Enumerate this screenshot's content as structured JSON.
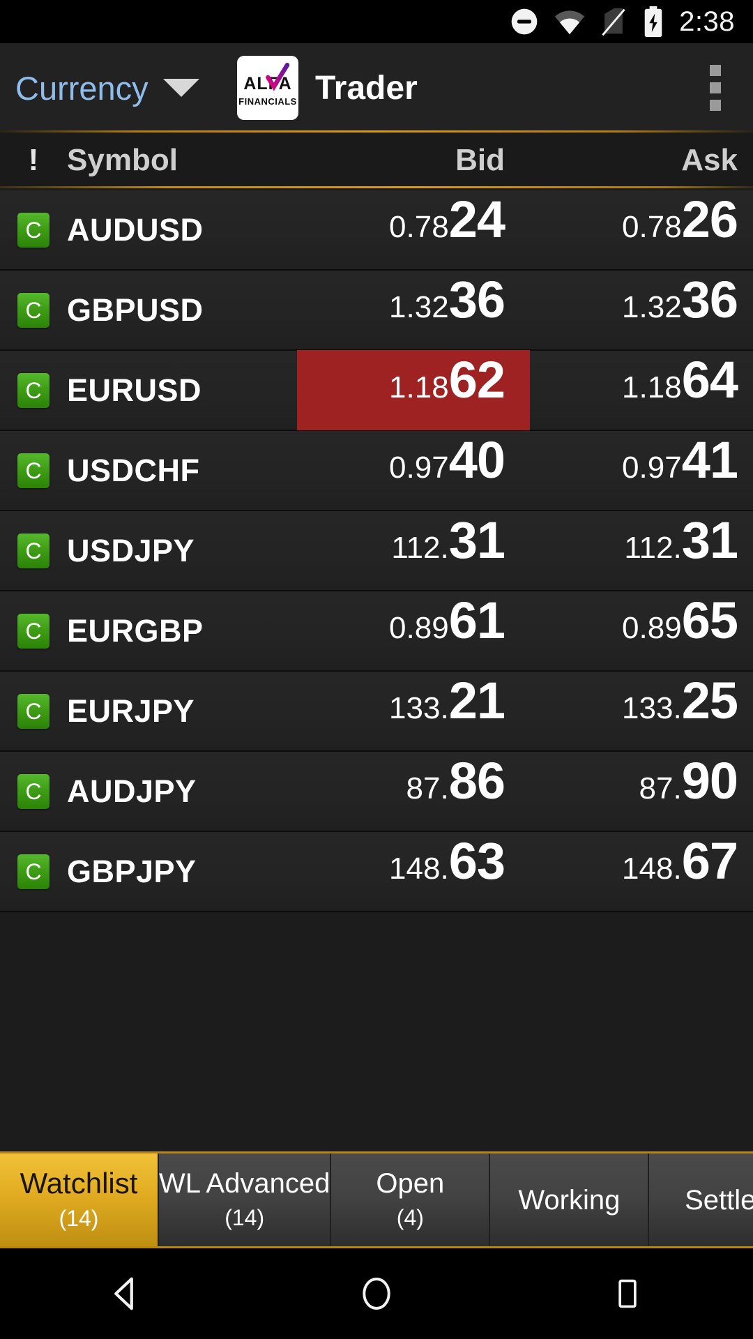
{
  "status_bar": {
    "time": "2:38",
    "icons": [
      "do-not-disturb-icon",
      "wifi-icon",
      "no-sim-icon",
      "battery-charging-icon"
    ]
  },
  "app_bar": {
    "currency_selector": "Currency",
    "dropdown_icon": "spinner-caret-icon",
    "logo_primary": "ALFA",
    "logo_secondary": "FINANCIALS",
    "title": "Trader",
    "overflow_icon": "overflow-menu-icon"
  },
  "table": {
    "headers": {
      "alert": "!",
      "symbol": "Symbol",
      "bid": "Bid",
      "ask": "Ask"
    },
    "rows": [
      {
        "flag": "C",
        "symbol": "AUDUSD",
        "bid_small": "0.78",
        "bid_big": "24",
        "ask_small": "0.78",
        "ask_big": "26",
        "bid_flash": "none"
      },
      {
        "flag": "C",
        "symbol": "GBPUSD",
        "bid_small": "1.32",
        "bid_big": "36",
        "ask_small": "1.32",
        "ask_big": "36",
        "bid_flash": "none"
      },
      {
        "flag": "C",
        "symbol": "EURUSD",
        "bid_small": "1.18",
        "bid_big": "62",
        "ask_small": "1.18",
        "ask_big": "64",
        "bid_flash": "down"
      },
      {
        "flag": "C",
        "symbol": "USDCHF",
        "bid_small": "0.97",
        "bid_big": "40",
        "ask_small": "0.97",
        "ask_big": "41",
        "bid_flash": "none"
      },
      {
        "flag": "C",
        "symbol": "USDJPY",
        "bid_small": "112.",
        "bid_big": "31",
        "ask_small": "112.",
        "ask_big": "31",
        "bid_flash": "none"
      },
      {
        "flag": "C",
        "symbol": "EURGBP",
        "bid_small": "0.89",
        "bid_big": "61",
        "ask_small": "0.89",
        "ask_big": "65",
        "bid_flash": "none"
      },
      {
        "flag": "C",
        "symbol": "EURJPY",
        "bid_small": "133.",
        "bid_big": "21",
        "ask_small": "133.",
        "ask_big": "25",
        "bid_flash": "none"
      },
      {
        "flag": "C",
        "symbol": "AUDJPY",
        "bid_small": "87.",
        "bid_big": "86",
        "ask_small": "87.",
        "ask_big": "90",
        "bid_flash": "none"
      },
      {
        "flag": "C",
        "symbol": "GBPJPY",
        "bid_small": "148.",
        "bid_big": "63",
        "ask_small": "148.",
        "ask_big": "67",
        "bid_flash": "none"
      }
    ]
  },
  "tabs": [
    {
      "label": "Watchlist",
      "count": "(14)",
      "active": true
    },
    {
      "label": "WL Advanced",
      "count": "(14)",
      "active": false
    },
    {
      "label": "Open",
      "count": "(4)",
      "active": false
    },
    {
      "label": "Working",
      "count": "",
      "active": false
    },
    {
      "label": "Settled",
      "count": "",
      "active": false
    }
  ],
  "nav_bar": {
    "back": "back-icon",
    "home": "home-icon",
    "recents": "recents-icon"
  },
  "colors": {
    "accent_gold": "#d79a1c",
    "flash_down_red": "#9e2222",
    "flag_green": "#3f9e16",
    "currency_blue": "#8fbdeb",
    "app_bg": "#1c1c1c"
  }
}
